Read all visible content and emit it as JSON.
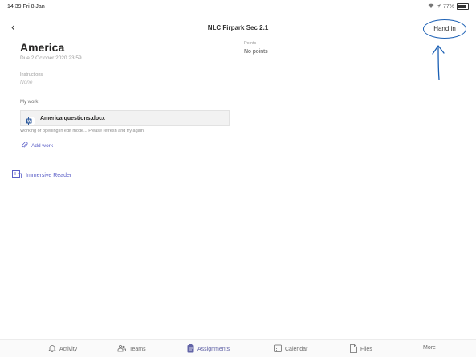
{
  "status": {
    "time": "14:39",
    "date": "Fri 8 Jan",
    "battery": "77%"
  },
  "header": {
    "title": "NLC Firpark Sec 2.1",
    "hand_in": "Hand in"
  },
  "assignment": {
    "title": "America",
    "due": "Due 2 October 2020 23:59",
    "points_label": "Points",
    "points_value": "No points",
    "instructions_label": "Instructions",
    "instructions_value": "None",
    "my_work_label": "My work",
    "file_name": "America questions.docx",
    "warning": "Working or opening in edit mode... Please refresh and try again.",
    "add_work": "Add work"
  },
  "immersive_reader": "Immersive Reader",
  "tabs": [
    {
      "label": "Activity",
      "icon": "bell-icon"
    },
    {
      "label": "Teams",
      "icon": "teams-icon"
    },
    {
      "label": "Assignments",
      "icon": "assignments-icon"
    },
    {
      "label": "Calendar",
      "icon": "calendar-icon"
    },
    {
      "label": "Files",
      "icon": "file-icon"
    },
    {
      "label": "More",
      "icon": "ellipsis-icon"
    }
  ],
  "colors": {
    "accent": "#6264a7",
    "link": "#5b5fc7",
    "annotation": "#1a5fb4"
  }
}
